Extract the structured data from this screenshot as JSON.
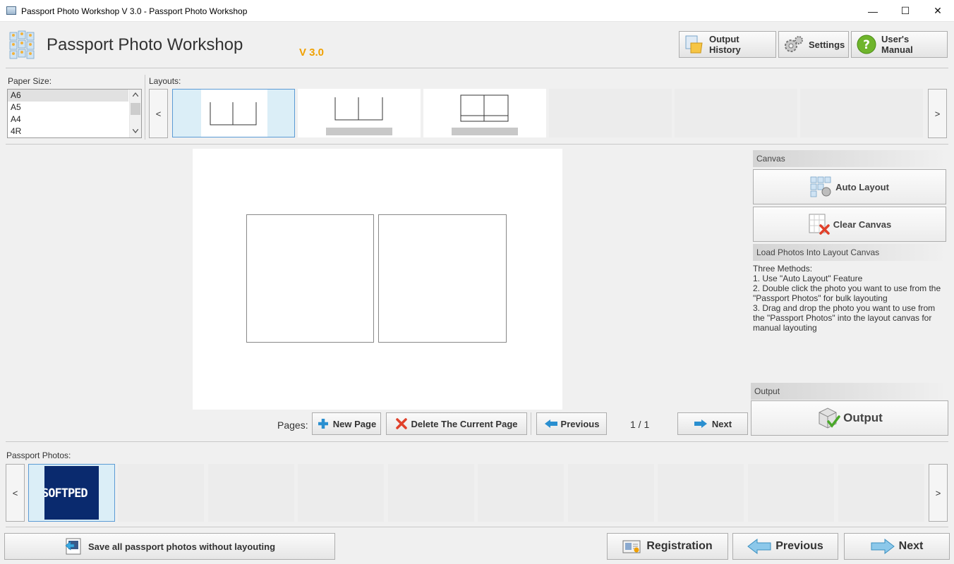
{
  "window": {
    "title": "Passport Photo Workshop V 3.0 - Passport Photo Workshop",
    "minimize": "—",
    "maximize": "☐",
    "close": "✕"
  },
  "header": {
    "title": "Passport Photo Workshop",
    "version": "V 3.0",
    "buttons": {
      "output_history": "Output History",
      "settings": "Settings",
      "users_manual": "User's Manual"
    }
  },
  "paper_size": {
    "label": "Paper Size:",
    "options": [
      "A6",
      "A5",
      "A4",
      "4R"
    ],
    "selected": "A6"
  },
  "layouts": {
    "label": "Layouts:",
    "prev": "<",
    "next": ">"
  },
  "canvas_panel": {
    "header": "Canvas",
    "auto_layout": "Auto Layout",
    "clear_canvas": "Clear Canvas",
    "load_header": "Load Photos Into Layout Canvas",
    "methods_title": "Three Methods:",
    "methods": [
      "1. Use \"Auto Layout\" Feature",
      "2. Double click the photo you want to use from the \"Passport Photos\" for bulk layouting",
      "3. Drag and drop the photo you want to use from the \"Passport Photos\" into the layout canvas for manual layouting"
    ],
    "output_header": "Output",
    "output_button": "Output"
  },
  "pages": {
    "label": "Pages:",
    "new_page": "New Page",
    "delete_page": "Delete The Current Page",
    "previous": "Previous",
    "counter": "1 / 1",
    "next": "Next"
  },
  "passport_photos": {
    "label": "Passport Photos:",
    "prev": "<",
    "next": ">",
    "thumb_text": "SOFTPED"
  },
  "footer": {
    "save_all": "Save all passport photos without layouting",
    "registration": "Registration",
    "previous": "Previous",
    "next": "Next"
  },
  "colors": {
    "accent": "#5b9bd5",
    "version": "#f0a000",
    "selection": "#dbeef7"
  }
}
